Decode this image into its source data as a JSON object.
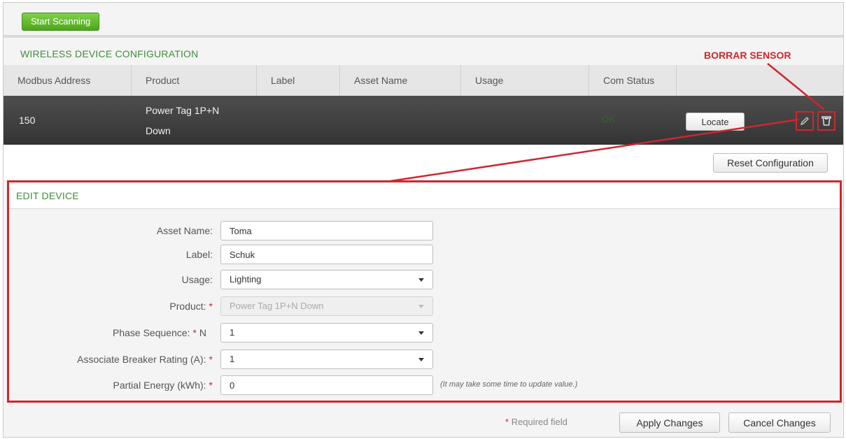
{
  "toolbar": {
    "start_scanning_label": "Start Scanning"
  },
  "config": {
    "title": "WIRELESS DEVICE CONFIGURATION",
    "columns": [
      "Modbus Address",
      "Product",
      "Label",
      "Asset Name",
      "Usage",
      "Com Status"
    ],
    "row": {
      "modbus_address": "150",
      "product_line1": "Power Tag 1P+N",
      "product_line2": "Down",
      "label": "",
      "asset_name": "",
      "usage": "",
      "com_status": "OK",
      "locate_label": "Locate"
    },
    "reset_label": "Reset Configuration"
  },
  "annotation": {
    "text": "BORRAR SENSOR",
    "color": "#d0262e"
  },
  "edit": {
    "title": "EDIT DEVICE",
    "asset_name": {
      "label": "Asset Name:",
      "value": "Toma"
    },
    "label": {
      "label": "Label:",
      "value": "Schuk"
    },
    "usage": {
      "label": "Usage:",
      "value": "Lighting"
    },
    "product": {
      "label": "Product:",
      "value": "Power Tag 1P+N Down"
    },
    "phase_sequence": {
      "label": "Phase Sequence:",
      "prefix": "N",
      "value": "1"
    },
    "breaker_rating": {
      "label": "Associate Breaker Rating (A):",
      "value": "1"
    },
    "partial_energy": {
      "label": "Partial Energy (kWh):",
      "value": "0",
      "hint": "(It may take some time to update value.)"
    },
    "required_star": "*"
  },
  "footer": {
    "required_note": "Required field",
    "apply_label": "Apply Changes",
    "cancel_label": "Cancel Changes"
  },
  "colors": {
    "accent_green": "#3f8e3b",
    "annotation_red": "#d0262e",
    "row_dark": "#3c3c3c"
  },
  "icons": {
    "edit": "pencil-icon",
    "delete": "trash-icon",
    "dropdown": "caret-down-icon"
  }
}
